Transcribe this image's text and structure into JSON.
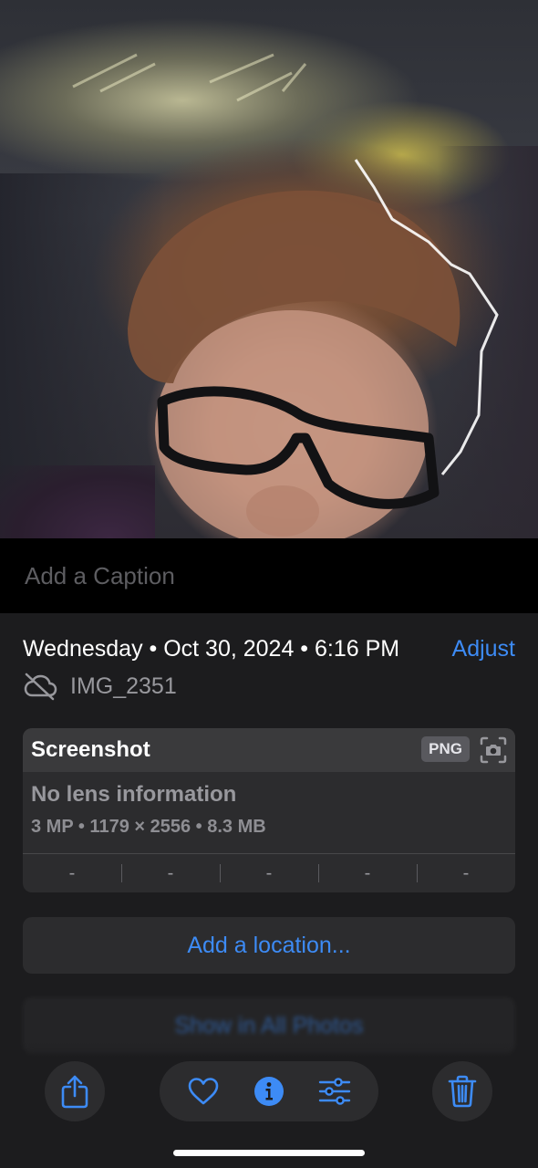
{
  "photo": {
    "subject": "selfie-photo"
  },
  "caption": {
    "placeholder": "Add a Caption"
  },
  "info": {
    "date_time": "Wednesday • Oct 30, 2024 • 6:16 PM",
    "adjust_label": "Adjust",
    "filename": "IMG_2351",
    "cloud_icon": "cloud-off-icon"
  },
  "card": {
    "title": "Screenshot",
    "format_badge": "PNG",
    "badge_icon": "screenshot-camera-icon",
    "lens": "No lens information",
    "specs": "3 MP  •  1179 × 2556  •  8.3 MB",
    "exif": [
      "-",
      "-",
      "-",
      "-",
      "-"
    ]
  },
  "buttons": {
    "add_location": "Add a location...",
    "show_all_photos": "Show in All Photos"
  },
  "toolbar": {
    "share_icon": "share-icon",
    "favorite_icon": "heart-icon",
    "info_icon": "info-icon",
    "edit_icon": "adjust-sliders-icon",
    "delete_icon": "trash-icon"
  },
  "colors": {
    "accent": "#3d8bf5",
    "background": "#1c1c1e",
    "card": "#2c2c2e"
  }
}
